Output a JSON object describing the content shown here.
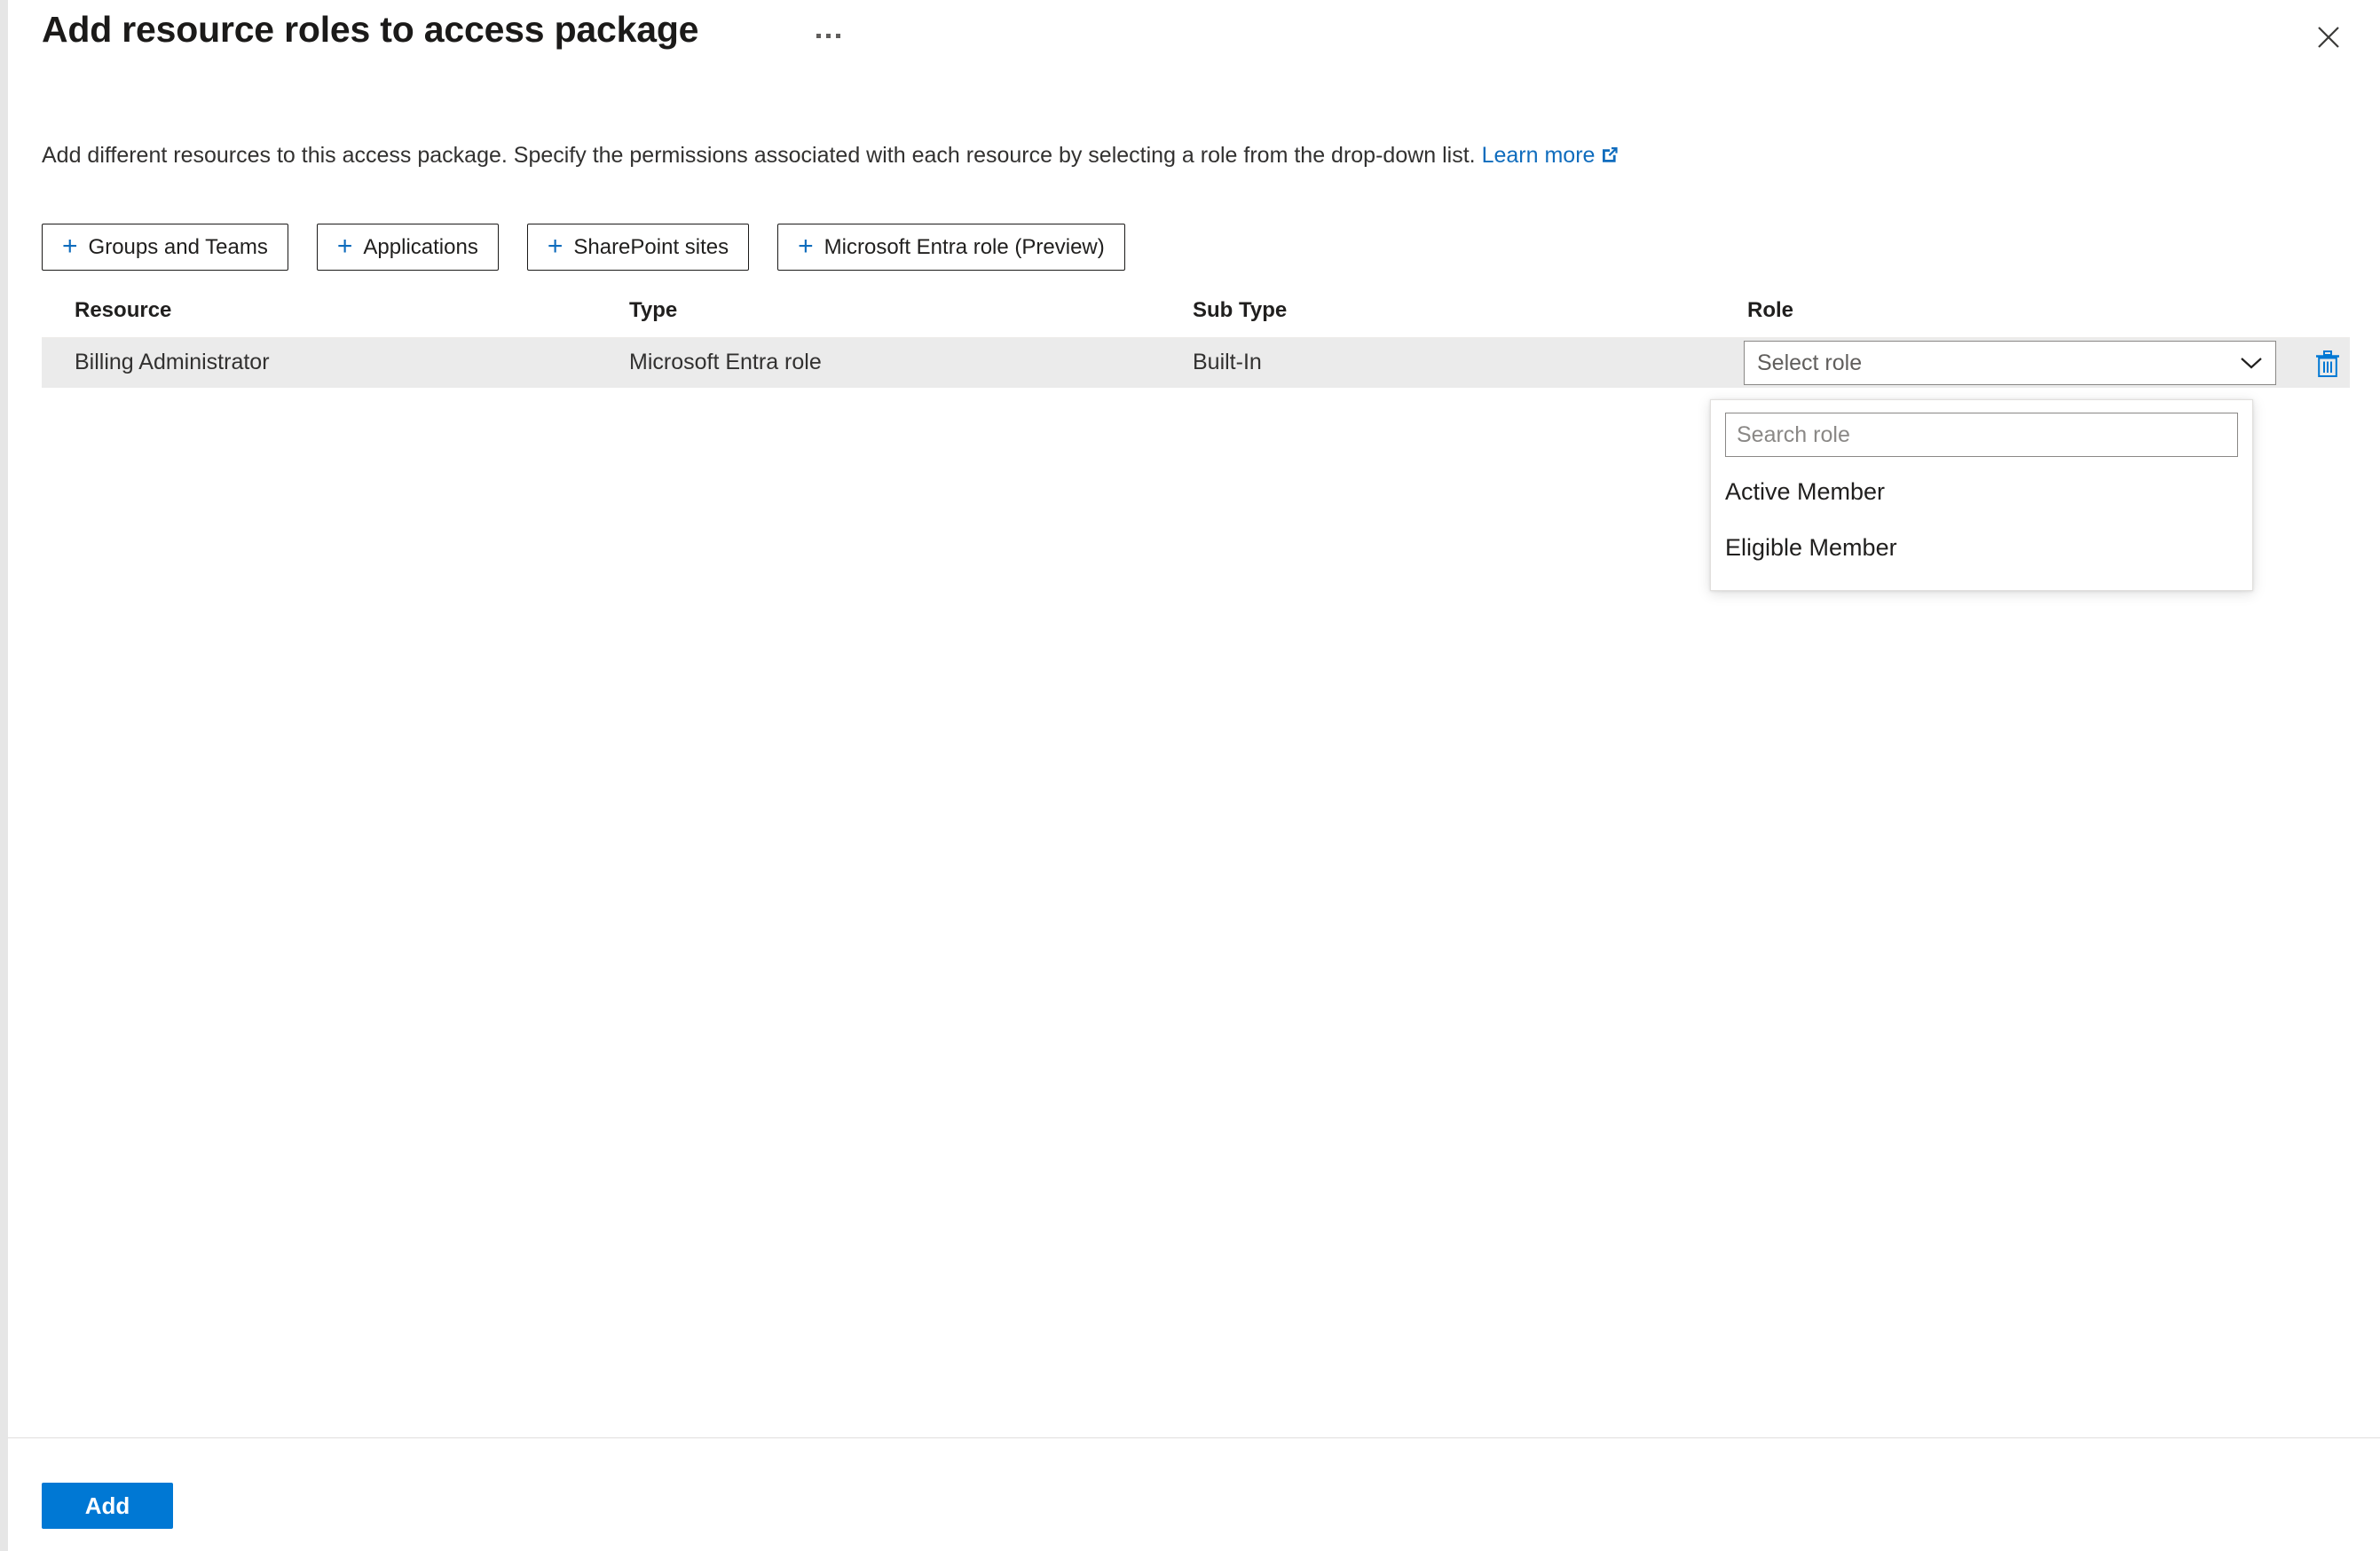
{
  "header": {
    "title": "Add resource roles to access package",
    "more_menu_icon": "ellipsis-icon",
    "close_icon": "close-icon"
  },
  "description": {
    "text": "Add different resources to this access package. Specify the permissions associated with each resource by selecting a role from the drop-down list.",
    "learn_more_label": "Learn more",
    "external_link_icon": "external-link-icon"
  },
  "command_bar": {
    "buttons": [
      {
        "label": "Groups and Teams",
        "icon": "plus-icon"
      },
      {
        "label": "Applications",
        "icon": "plus-icon"
      },
      {
        "label": "SharePoint sites",
        "icon": "plus-icon"
      },
      {
        "label": "Microsoft Entra role (Preview)",
        "icon": "plus-icon"
      }
    ]
  },
  "table": {
    "columns": [
      "Resource",
      "Type",
      "Sub Type",
      "Role"
    ],
    "rows": [
      {
        "resource": "Billing Administrator",
        "type": "Microsoft Entra role",
        "sub_type": "Built-In",
        "role_placeholder": "Select role",
        "chevron_icon": "chevron-down-icon",
        "delete_icon": "trash-icon"
      }
    ]
  },
  "role_dropdown": {
    "open": true,
    "search_placeholder": "Search role",
    "search_value": "",
    "options": [
      "Active Member",
      "Eligible Member"
    ]
  },
  "footer": {
    "add_label": "Add"
  },
  "colors": {
    "accent": "#0078d4",
    "link": "#0f6cbd",
    "row_selected_bg": "#ebebeb",
    "border": "#8a8886"
  }
}
